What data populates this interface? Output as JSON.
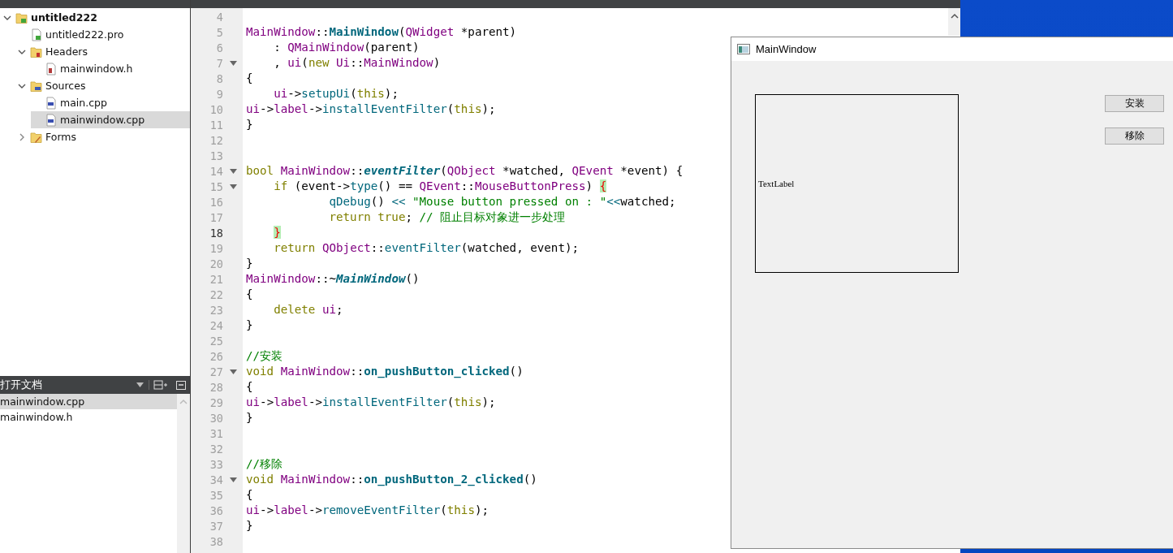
{
  "project_tree": [
    {
      "label": "untitled222",
      "kind": "project",
      "expanded": true,
      "selected": false,
      "children": [
        {
          "label": "untitled222.pro",
          "kind": "pro",
          "selected": false
        },
        {
          "label": "Headers",
          "kind": "headers",
          "expanded": true,
          "selected": false,
          "children": [
            {
              "label": "mainwindow.h",
              "kind": "h",
              "selected": false
            }
          ]
        },
        {
          "label": "Sources",
          "kind": "sources",
          "expanded": true,
          "selected": false,
          "children": [
            {
              "label": "main.cpp",
              "kind": "cpp",
              "selected": false
            },
            {
              "label": "mainwindow.cpp",
              "kind": "cpp",
              "selected": true
            }
          ]
        },
        {
          "label": "Forms",
          "kind": "forms",
          "expanded": false,
          "selected": false
        }
      ]
    }
  ],
  "open_documents": {
    "title": "打开文档",
    "items": [
      {
        "label": "mainwindow.cpp",
        "selected": true
      },
      {
        "label": "mainwindow.h",
        "selected": false
      }
    ]
  },
  "code_lines": [
    {
      "number": "4",
      "fold": false,
      "current": false
    },
    {
      "number": "5",
      "fold": false,
      "current": false,
      "segments": [
        {
          "kind": "type",
          "text": "MainWindow"
        },
        {
          "kind": "txt",
          "text": "::"
        },
        {
          "kind": "fnb",
          "text": "MainWindow"
        },
        {
          "kind": "txt",
          "text": "("
        },
        {
          "kind": "type",
          "text": "QWidget"
        },
        {
          "kind": "txt",
          "text": " *parent)"
        }
      ]
    },
    {
      "number": "6",
      "fold": false,
      "current": false,
      "segments": [
        {
          "kind": "txt",
          "text": "    : "
        },
        {
          "kind": "type",
          "text": "QMainWindow"
        },
        {
          "kind": "txt",
          "text": "(parent)"
        }
      ]
    },
    {
      "number": "7",
      "fold": true,
      "current": false,
      "segments": [
        {
          "kind": "txt",
          "text": "    , "
        },
        {
          "kind": "mem",
          "text": "ui"
        },
        {
          "kind": "txt",
          "text": "("
        },
        {
          "kind": "kw",
          "text": "new"
        },
        {
          "kind": "type",
          "text": " Ui"
        },
        {
          "kind": "txt",
          "text": "::"
        },
        {
          "kind": "type",
          "text": "MainWindow"
        },
        {
          "kind": "txt",
          "text": ")"
        }
      ]
    },
    {
      "number": "8",
      "fold": false,
      "current": false,
      "segments": [
        {
          "kind": "txt",
          "text": "{"
        }
      ]
    },
    {
      "number": "9",
      "fold": false,
      "current": false,
      "segments": [
        {
          "kind": "mem",
          "text": "    ui"
        },
        {
          "kind": "txt",
          "text": "->"
        },
        {
          "kind": "fn",
          "text": "setupUi"
        },
        {
          "kind": "txt",
          "text": "("
        },
        {
          "kind": "kw",
          "text": "this"
        },
        {
          "kind": "txt",
          "text": ");"
        }
      ]
    },
    {
      "number": "10",
      "fold": false,
      "current": false,
      "segments": [
        {
          "kind": "mem",
          "text": "ui"
        },
        {
          "kind": "txt",
          "text": "->"
        },
        {
          "kind": "mem",
          "text": "label"
        },
        {
          "kind": "txt",
          "text": "->"
        },
        {
          "kind": "fn",
          "text": "installEventFilter"
        },
        {
          "kind": "txt",
          "text": "("
        },
        {
          "kind": "kw",
          "text": "this"
        },
        {
          "kind": "txt",
          "text": ");"
        }
      ]
    },
    {
      "number": "11",
      "fold": false,
      "current": false,
      "segments": [
        {
          "kind": "txt",
          "text": "}"
        }
      ]
    },
    {
      "number": "12",
      "fold": false,
      "current": false
    },
    {
      "number": "13",
      "fold": false,
      "current": false
    },
    {
      "number": "14",
      "fold": true,
      "current": false,
      "segments": [
        {
          "kind": "kw",
          "text": "bool"
        },
        {
          "kind": "type",
          "text": " MainWindow"
        },
        {
          "kind": "txt",
          "text": "::"
        },
        {
          "kind": "fni",
          "text": "eventFilter"
        },
        {
          "kind": "txt",
          "text": "("
        },
        {
          "kind": "type",
          "text": "QObject"
        },
        {
          "kind": "txt",
          "text": " *watched, "
        },
        {
          "kind": "type",
          "text": "QEvent"
        },
        {
          "kind": "txt",
          "text": " *event) {"
        }
      ]
    },
    {
      "number": "15",
      "fold": true,
      "current": false,
      "segments": [
        {
          "kind": "kw",
          "text": "    if"
        },
        {
          "kind": "txt",
          "text": " (event->"
        },
        {
          "kind": "fn",
          "text": "type"
        },
        {
          "kind": "txt",
          "text": "() == "
        },
        {
          "kind": "type",
          "text": "QEvent"
        },
        {
          "kind": "txt",
          "text": "::"
        },
        {
          "kind": "mem",
          "text": "MouseButtonPress"
        },
        {
          "kind": "txt",
          "text": ") "
        },
        {
          "kind": "match",
          "text": "{"
        }
      ]
    },
    {
      "number": "16",
      "fold": false,
      "current": false,
      "segments": [
        {
          "kind": "fn",
          "text": "            qDebug"
        },
        {
          "kind": "txt",
          "text": "() "
        },
        {
          "kind": "fn",
          "text": "<<"
        },
        {
          "kind": "str",
          "text": " \"Mouse button pressed on : \""
        },
        {
          "kind": "fn",
          "text": "<<"
        },
        {
          "kind": "txt",
          "text": "watched;"
        }
      ]
    },
    {
      "number": "17",
      "fold": false,
      "current": false,
      "segments": [
        {
          "kind": "kw",
          "text": "            return"
        },
        {
          "kind": "kw",
          "text": " true"
        },
        {
          "kind": "txt",
          "text": "; "
        },
        {
          "kind": "com",
          "text": "// 阻止目标对象进一步处理"
        }
      ]
    },
    {
      "number": "18",
      "fold": false,
      "current": true,
      "segments": [
        {
          "kind": "match",
          "text": "    }"
        }
      ]
    },
    {
      "number": "19",
      "fold": false,
      "current": false,
      "segments": [
        {
          "kind": "kw",
          "text": "    return"
        },
        {
          "kind": "type",
          "text": " QObject"
        },
        {
          "kind": "txt",
          "text": "::"
        },
        {
          "kind": "fn",
          "text": "eventFilter"
        },
        {
          "kind": "txt",
          "text": "(watched, event);"
        }
      ]
    },
    {
      "number": "20",
      "fold": false,
      "current": false,
      "segments": [
        {
          "kind": "txt",
          "text": "}"
        }
      ]
    },
    {
      "number": "21",
      "fold": false,
      "current": false,
      "segments": [
        {
          "kind": "type",
          "text": "MainWindow"
        },
        {
          "kind": "txt",
          "text": "::~"
        },
        {
          "kind": "fni",
          "text": "MainWindow"
        },
        {
          "kind": "txt",
          "text": "()"
        }
      ]
    },
    {
      "number": "22",
      "fold": false,
      "current": false,
      "segments": [
        {
          "kind": "txt",
          "text": "{"
        }
      ]
    },
    {
      "number": "23",
      "fold": false,
      "current": false,
      "segments": [
        {
          "kind": "kw",
          "text": "    delete"
        },
        {
          "kind": "mem",
          "text": " ui"
        },
        {
          "kind": "txt",
          "text": ";"
        }
      ]
    },
    {
      "number": "24",
      "fold": false,
      "current": false,
      "segments": [
        {
          "kind": "txt",
          "text": "}"
        }
      ]
    },
    {
      "number": "25",
      "fold": false,
      "current": false
    },
    {
      "number": "26",
      "fold": false,
      "current": false,
      "segments": [
        {
          "kind": "com",
          "text": "//安装"
        }
      ]
    },
    {
      "number": "27",
      "fold": true,
      "current": false,
      "segments": [
        {
          "kind": "kw",
          "text": "void"
        },
        {
          "kind": "type",
          "text": " MainWindow"
        },
        {
          "kind": "txt",
          "text": "::"
        },
        {
          "kind": "fnb",
          "text": "on_pushButton_clicked"
        },
        {
          "kind": "txt",
          "text": "()"
        }
      ]
    },
    {
      "number": "28",
      "fold": false,
      "current": false,
      "segments": [
        {
          "kind": "txt",
          "text": "{"
        }
      ]
    },
    {
      "number": "29",
      "fold": false,
      "current": false,
      "segments": [
        {
          "kind": "mem",
          "text": "ui"
        },
        {
          "kind": "txt",
          "text": "->"
        },
        {
          "kind": "mem",
          "text": "label"
        },
        {
          "kind": "txt",
          "text": "->"
        },
        {
          "kind": "fn",
          "text": "installEventFilter"
        },
        {
          "kind": "txt",
          "text": "("
        },
        {
          "kind": "kw",
          "text": "this"
        },
        {
          "kind": "txt",
          "text": ");"
        }
      ]
    },
    {
      "number": "30",
      "fold": false,
      "current": false,
      "segments": [
        {
          "kind": "txt",
          "text": "}"
        }
      ]
    },
    {
      "number": "31",
      "fold": false,
      "current": false
    },
    {
      "number": "32",
      "fold": false,
      "current": false
    },
    {
      "number": "33",
      "fold": false,
      "current": false,
      "segments": [
        {
          "kind": "com",
          "text": "//移除"
        }
      ]
    },
    {
      "number": "34",
      "fold": true,
      "current": false,
      "segments": [
        {
          "kind": "kw",
          "text": "void"
        },
        {
          "kind": "type",
          "text": " MainWindow"
        },
        {
          "kind": "txt",
          "text": "::"
        },
        {
          "kind": "fnb",
          "text": "on_pushButton_2_clicked"
        },
        {
          "kind": "txt",
          "text": "()"
        }
      ]
    },
    {
      "number": "35",
      "fold": false,
      "current": false,
      "segments": [
        {
          "kind": "txt",
          "text": "{"
        }
      ]
    },
    {
      "number": "36",
      "fold": false,
      "current": false,
      "segments": [
        {
          "kind": "mem",
          "text": "ui"
        },
        {
          "kind": "txt",
          "text": "->"
        },
        {
          "kind": "mem",
          "text": "label"
        },
        {
          "kind": "txt",
          "text": "->"
        },
        {
          "kind": "fn",
          "text": "removeEventFilter"
        },
        {
          "kind": "txt",
          "text": "("
        },
        {
          "kind": "kw",
          "text": "this"
        },
        {
          "kind": "txt",
          "text": ");"
        }
      ]
    },
    {
      "number": "37",
      "fold": false,
      "current": false,
      "segments": [
        {
          "kind": "txt",
          "text": "}"
        }
      ]
    },
    {
      "number": "38",
      "fold": false,
      "current": false
    }
  ],
  "app_window": {
    "title": "MainWindow",
    "label": "TextLabel",
    "buttons": [
      "安装",
      "移除"
    ]
  }
}
